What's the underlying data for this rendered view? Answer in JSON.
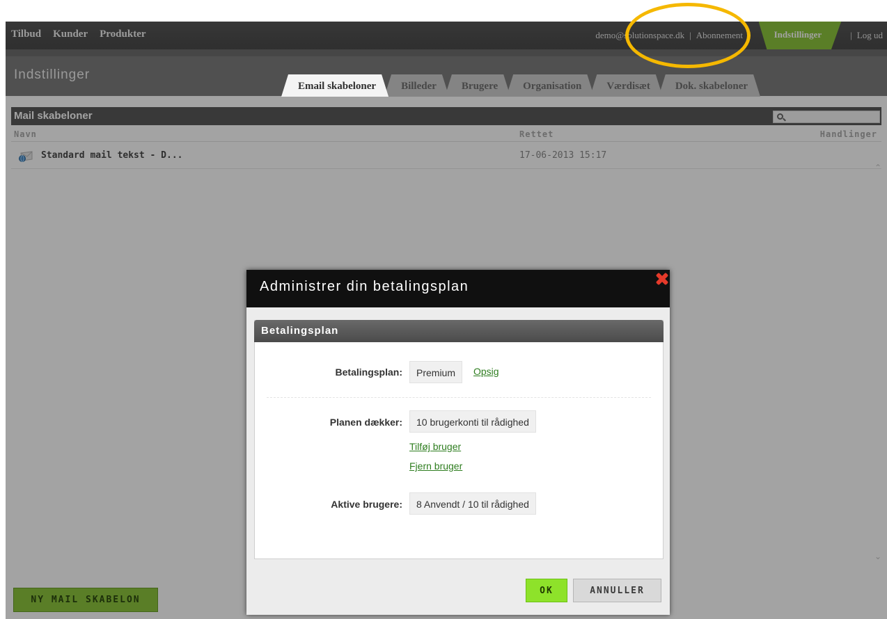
{
  "topnav": {
    "items": [
      "Tilbud",
      "Kunder",
      "Produkter"
    ],
    "user_email": "demo@solutionspace.dk",
    "subscription": "Abonnement",
    "separator": "|",
    "settings": "Indstillinger",
    "logout": "Log ud"
  },
  "header": {
    "title": "Indstillinger",
    "tabs": [
      "Email skabeloner",
      "Billeder",
      "Brugere",
      "Organisation",
      "Værdisæt",
      "Dok. skabeloner"
    ]
  },
  "panel": {
    "title": "Mail skabeloner",
    "columns": {
      "name": "Navn",
      "edited": "Rettet",
      "actions": "Handlinger"
    },
    "rows": [
      {
        "name": "Standard mail tekst - D...",
        "edited": "17-06-2013 15:17"
      }
    ],
    "new_button": "NY MAIL SKABELON"
  },
  "modal": {
    "title": "Administrer din betalingsplan",
    "section_title": "Betalingsplan",
    "plan_label": "Betalingsplan:",
    "plan_value": "Premium",
    "cancel_plan_link": "Opsig",
    "covers_label": "Planen dækker:",
    "covers_value": "10 brugerkonti til rådighed",
    "add_user_link": "Tilføj bruger",
    "remove_user_link": "Fjern bruger",
    "active_label": "Aktive brugere:",
    "active_value": "8 Anvendt / 10 til rådighed",
    "ok_button": "OK",
    "cancel_button": "ANNULLER"
  },
  "colors": {
    "accent_green": "#8dc53e",
    "ok_green": "#8ee22a",
    "close_red": "#e53a2a",
    "annotation_yellow": "#f5b800",
    "dark_header": "#101010"
  }
}
